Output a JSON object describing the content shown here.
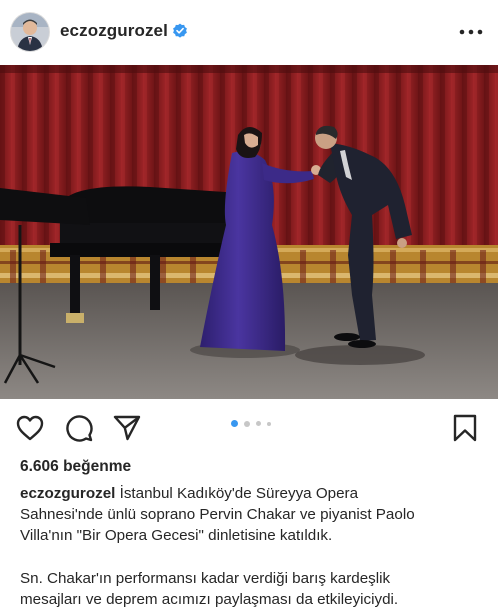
{
  "post": {
    "username": "eczozgurozel",
    "verified": true,
    "icons": {
      "avatar": "profile-photo",
      "verified": "verified-badge-icon",
      "more": "more-options-icon",
      "like": "heart-icon",
      "comment": "comment-bubble-icon",
      "share": "paper-plane-icon",
      "save": "bookmark-icon"
    },
    "carousel": {
      "total": 4,
      "active": 1
    },
    "likes": "6.606 beğenme",
    "caption": {
      "username": "eczozgurozel",
      "line1": "İstanbul Kadıköy'de Süreyya Opera",
      "line2": "Sahnesi'nde ünlü soprano Pervin Chakar ve piyanist Paolo",
      "line3": "Villa'nın \"Bir Opera Gecesi\" dinletisine katıldık.",
      "line4": "Sn. Chakar'ın performansı kadar verdiği barış kardeşlik",
      "line5": "mesajları ve deprem acımızı paylaşması da etkileyiciydi."
    },
    "colors": {
      "verified_blue": "#3897f0",
      "active_dot": "#3897f0",
      "curtain": "#8e1c1f",
      "gown": "#3e2a8a"
    }
  }
}
